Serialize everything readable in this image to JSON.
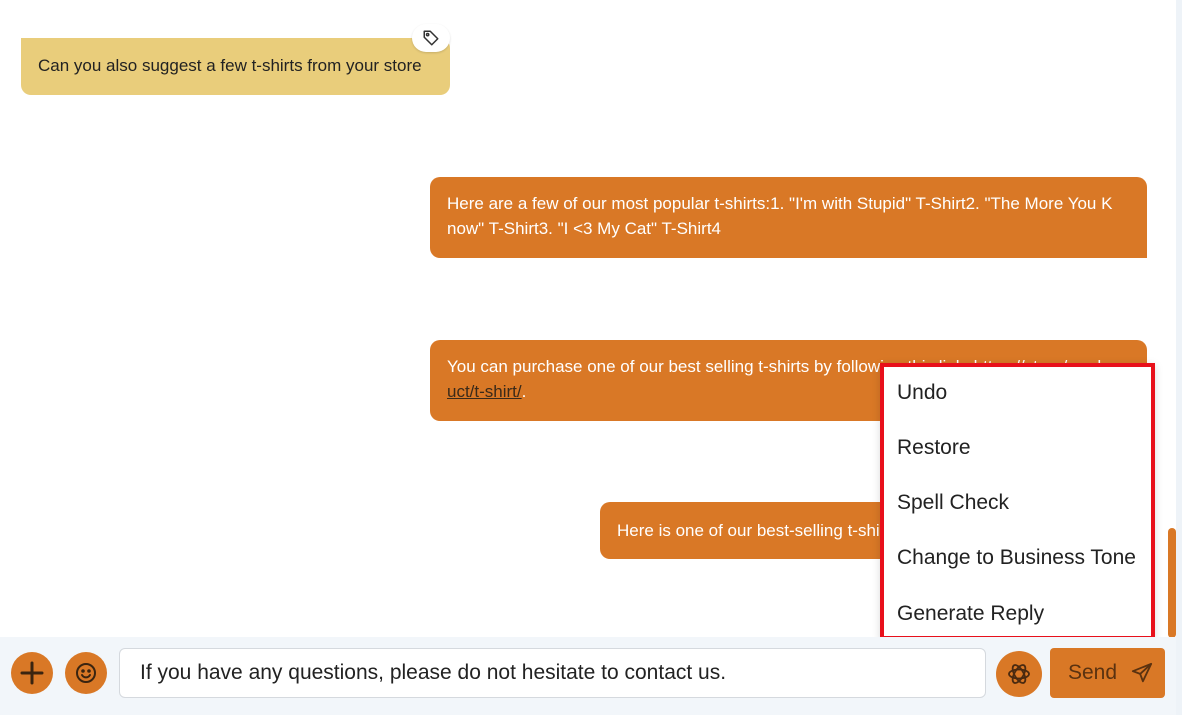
{
  "colors": {
    "accent": "#d97826",
    "incoming_bubble": "#e9cd7b",
    "highlight_border": "#e8101b"
  },
  "messages": {
    "incoming_1": "Can you also suggest a few t-shirts from your store",
    "outgoing_1": "Here are a few of our most popular t-shirts:1. \"I'm with Stupid\" T-Shirt2. \"The More You K now\" T-Shirt3. \"I <3 My Cat\" T-Shirt4",
    "outgoing_2_text": "You can purchase one of our best selling t-shirts by following this link: https://store/prod",
    "outgoing_2_link": "uct/t-shirt/",
    "outgoing_2_end": ".",
    "outgoing_3": "Here is one of our best-selling t-shirts"
  },
  "context_menu": {
    "items": [
      "Undo",
      "Restore",
      "Spell Check",
      "Change to Business Tone",
      "Generate Reply"
    ]
  },
  "composer": {
    "input_value": "If you have any questions, please do not hesitate to contact us.",
    "send_label": "Send"
  },
  "icons": {
    "tag": "tag-icon",
    "add": "plus-icon",
    "emoji": "smiley-icon",
    "ai": "openai-icon",
    "send": "paper-plane-icon"
  }
}
